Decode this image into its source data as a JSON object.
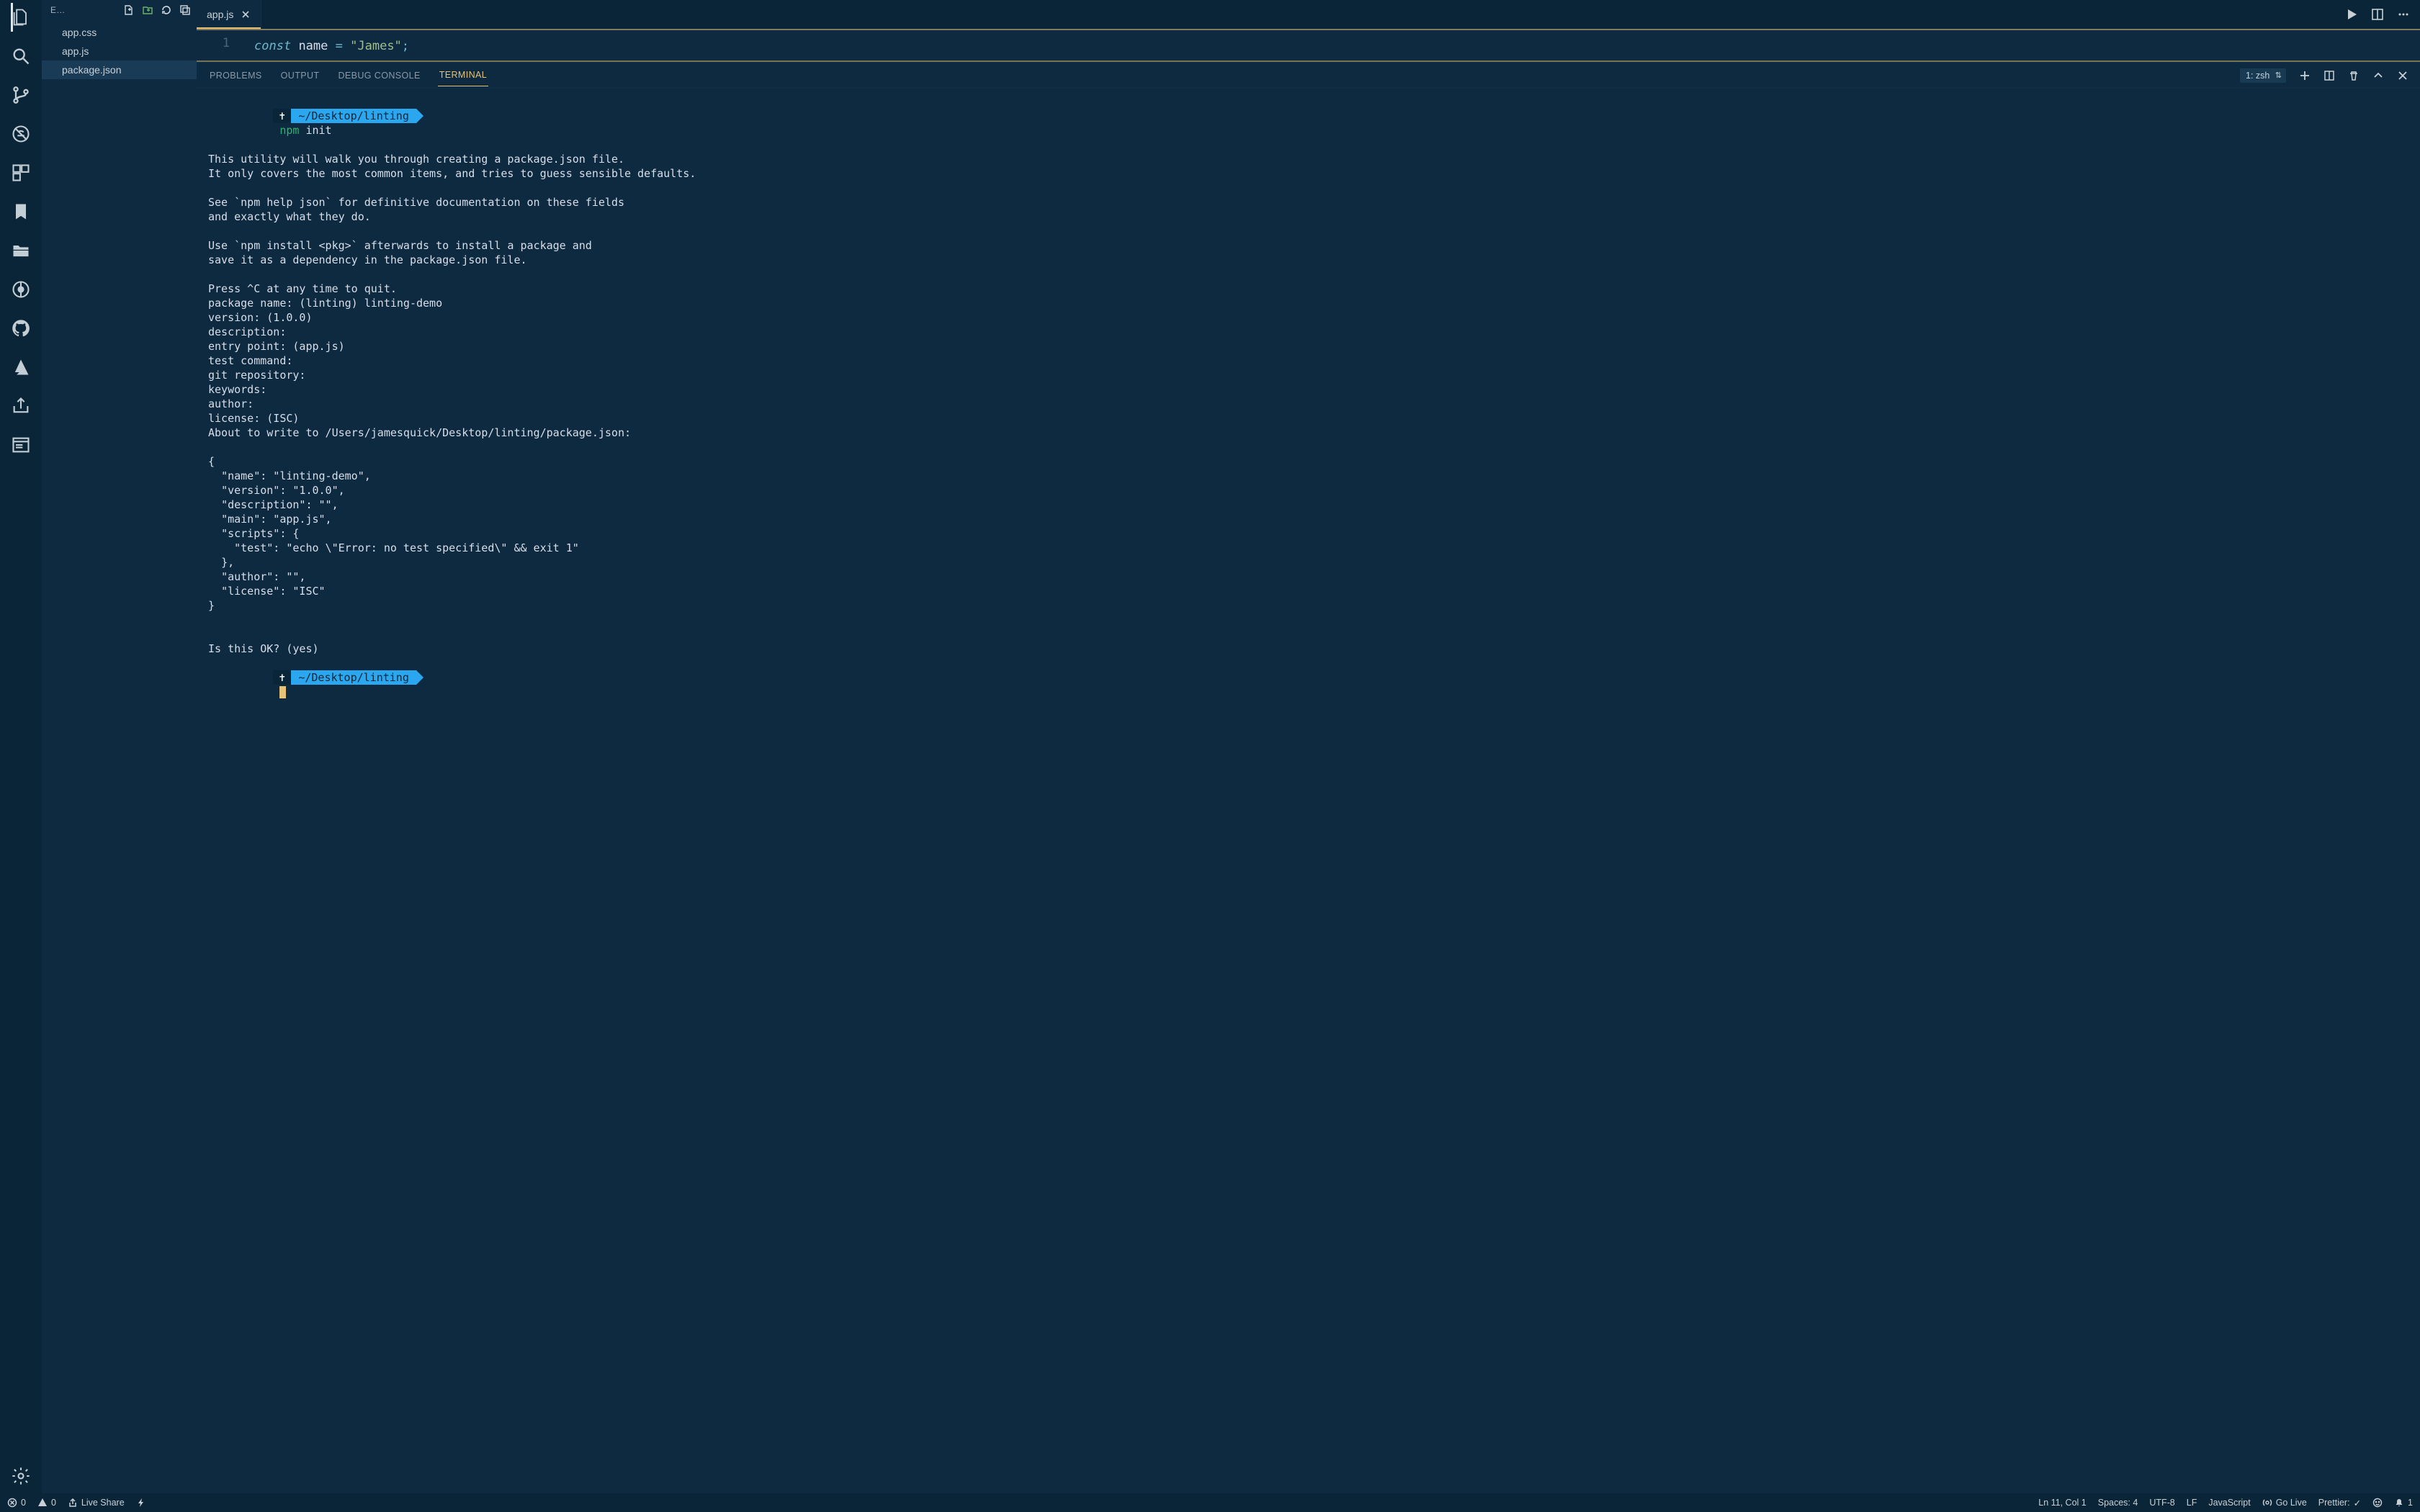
{
  "sidebar": {
    "header_label": "E…",
    "files": [
      "app.css",
      "app.js",
      "package.json"
    ],
    "active_index": 2
  },
  "tabs": {
    "items": [
      {
        "label": "app.js",
        "active": true
      }
    ]
  },
  "editor": {
    "line_number": "1",
    "code_tokens": {
      "kw": "const",
      "ident": "name",
      "op": "=",
      "str": "\"James\"",
      "punc": ";"
    }
  },
  "panel": {
    "tabs": [
      "PROBLEMS",
      "OUTPUT",
      "DEBUG CONSOLE",
      "TERMINAL"
    ],
    "active_tab": 3,
    "terminal_selector": "1: zsh"
  },
  "terminal": {
    "prompt_path": "~/Desktop/linting",
    "cmd_bin": "npm",
    "cmd_args": "init",
    "body": "This utility will walk you through creating a package.json file.\nIt only covers the most common items, and tries to guess sensible defaults.\n\nSee `npm help json` for definitive documentation on these fields\nand exactly what they do.\n\nUse `npm install <pkg>` afterwards to install a package and\nsave it as a dependency in the package.json file.\n\nPress ^C at any time to quit.\npackage name: (linting) linting-demo\nversion: (1.0.0) \ndescription: \nentry point: (app.js) \ntest command: \ngit repository: \nkeywords: \nauthor: \nlicense: (ISC) \nAbout to write to /Users/jamesquick/Desktop/linting/package.json:\n\n{\n  \"name\": \"linting-demo\",\n  \"version\": \"1.0.0\",\n  \"description\": \"\",\n  \"main\": \"app.js\",\n  \"scripts\": {\n    \"test\": \"echo \\\"Error: no test specified\\\" && exit 1\"\n  },\n  \"author\": \"\",\n  \"license\": \"ISC\"\n}\n\n\nIs this OK? (yes) "
  },
  "statusbar": {
    "errors": "0",
    "warnings": "0",
    "live_share": "Live Share",
    "cursor": "Ln 11, Col 1",
    "spaces": "Spaces: 4",
    "encoding": "UTF-8",
    "eol": "LF",
    "language": "JavaScript",
    "golive": "Go Live",
    "prettier": "Prettier: ",
    "bell": "1"
  }
}
